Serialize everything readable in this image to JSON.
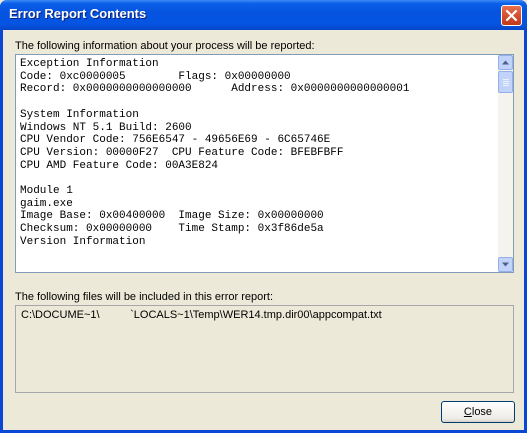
{
  "window": {
    "title": "Error Report Contents",
    "close_icon": "close-icon"
  },
  "report": {
    "label": "The following information about your process will be reported:",
    "lines": [
      "Exception Information",
      "Code: 0xc0000005        Flags: 0x00000000",
      "Record: 0x0000000000000000      Address: 0x0000000000000001",
      "",
      "System Information",
      "Windows NT 5.1 Build: 2600",
      "CPU Vendor Code: 756E6547 - 49656E69 - 6C65746E",
      "CPU Version: 00000F27  CPU Feature Code: BFEBFBFF",
      "CPU AMD Feature Code: 00A3E824",
      "",
      "Module 1",
      "gaim.exe",
      "Image Base: 0x00400000  Image Size: 0x00000000",
      "Checksum: 0x00000000    Time Stamp: 0x3f86de5a",
      "Version Information"
    ]
  },
  "files": {
    "label": "The following files will be included in this error report:",
    "items": [
      "C:\\DOCUME~1\\          `LOCALS~1\\Temp\\WER14.tmp.dir00\\appcompat.txt"
    ]
  },
  "buttons": {
    "close_mnemonic": "C",
    "close_rest": "lose"
  },
  "colors": {
    "titlebar": "#0553e0",
    "dialog_bg": "#ece9d8",
    "close_red": "#d24a2a"
  }
}
